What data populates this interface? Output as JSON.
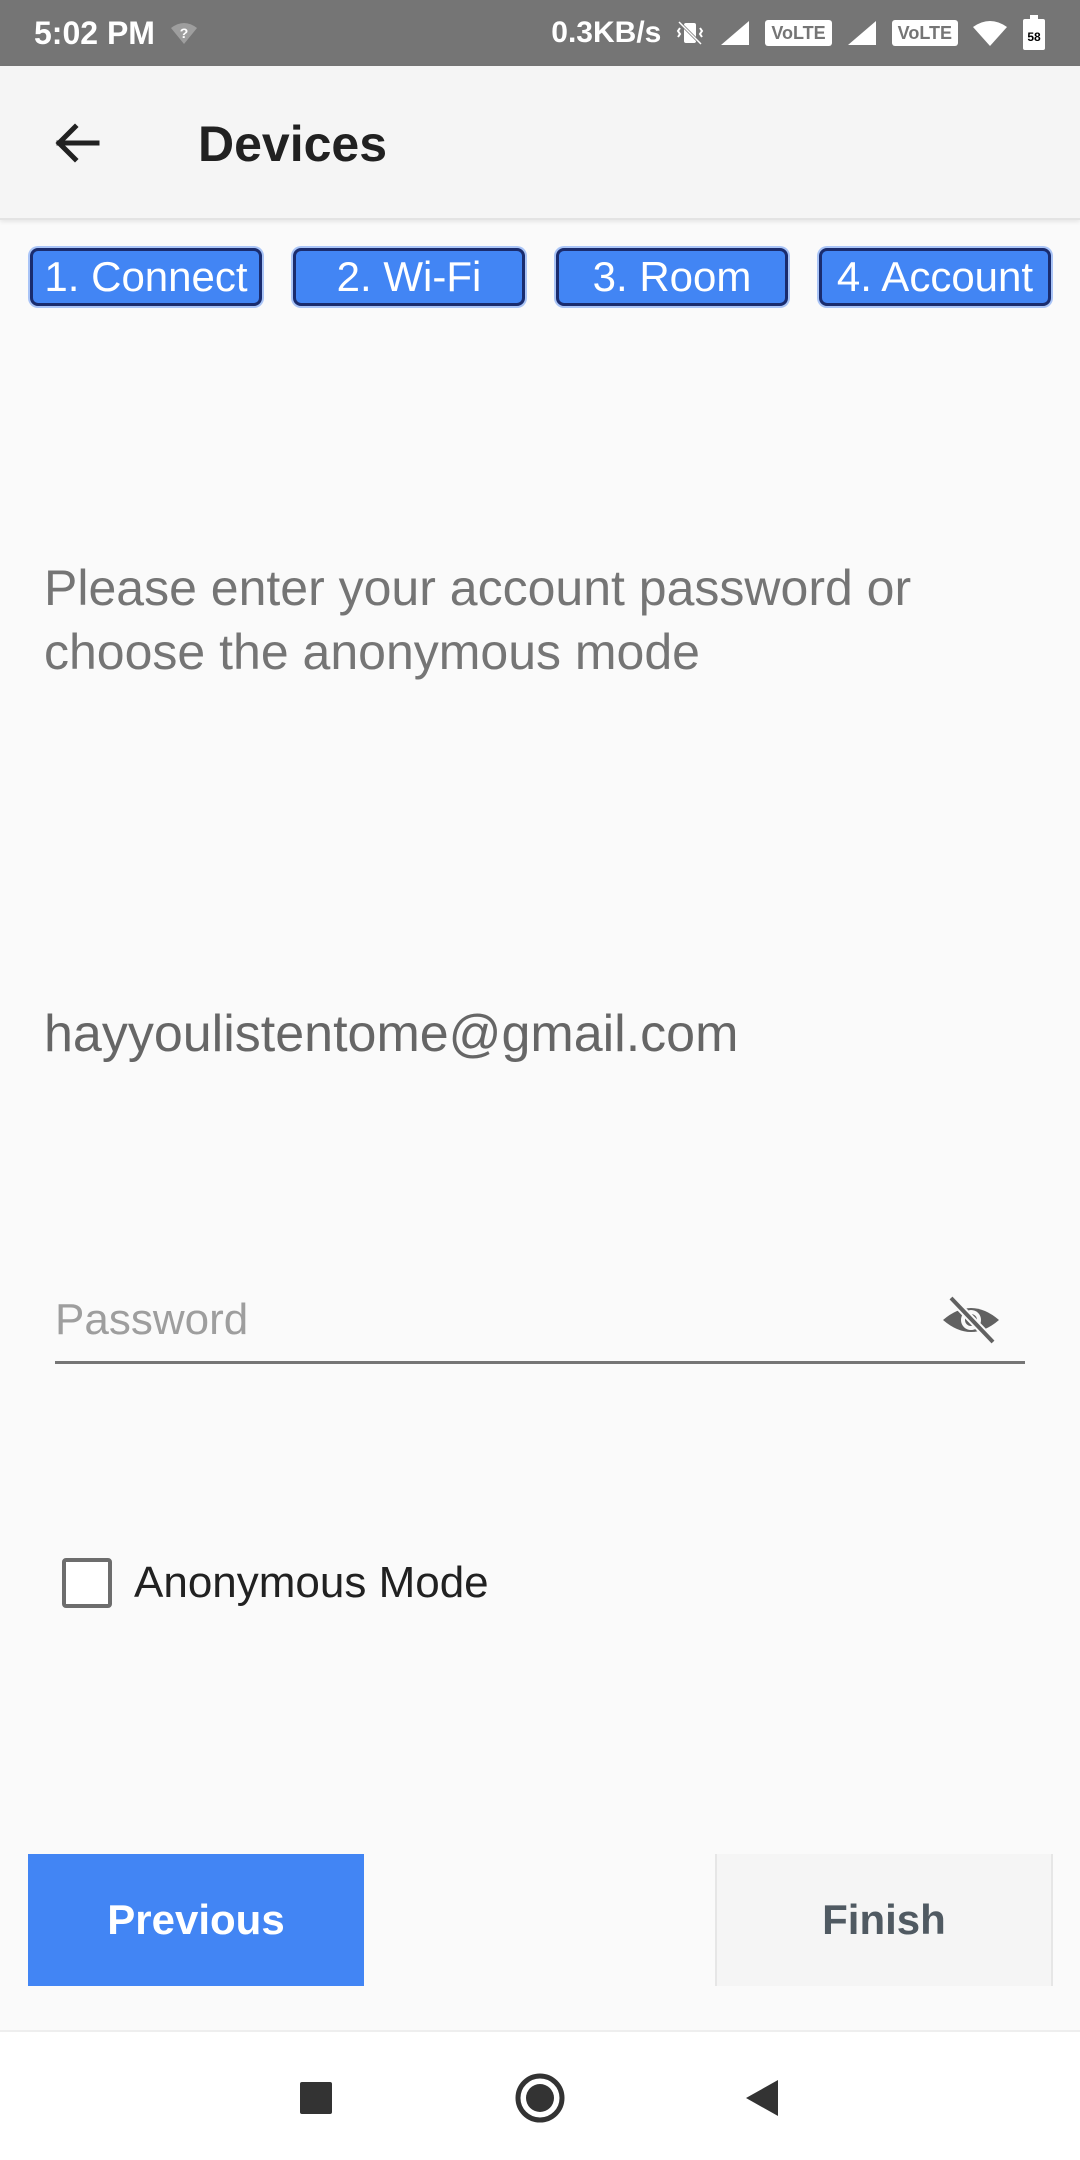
{
  "status_bar": {
    "time": "5:02 PM",
    "network_speed": "0.3KB/s",
    "volte_1": "VoLTE",
    "volte_2": "VoLTE",
    "battery": "58",
    "icons": [
      "wifi-question-icon",
      "vibrate-icon",
      "signal-icon",
      "signal-icon",
      "wifi-icon",
      "battery-icon"
    ]
  },
  "app_bar": {
    "title": "Devices",
    "back_icon": "arrow-left-icon"
  },
  "steps": [
    {
      "label": "1. Connect"
    },
    {
      "label": "2. Wi-Fi"
    },
    {
      "label": "3. Room"
    },
    {
      "label": "4. Account"
    }
  ],
  "content": {
    "instruction": "Please enter your account password or choose the anonymous mode",
    "email": "hayyoulistentome@gmail.com",
    "password": {
      "value": "",
      "placeholder": "Password",
      "visibility_icon": "eye-off-icon"
    },
    "anonymous": {
      "label": "Anonymous Mode",
      "checked": false
    }
  },
  "buttons": {
    "previous": "Previous",
    "finish": "Finish"
  },
  "colors": {
    "accent": "#4285f4",
    "status_bar": "#757575"
  },
  "nav_bar": {
    "icons": [
      "square-icon",
      "circle-icon",
      "triangle-back-icon"
    ]
  }
}
